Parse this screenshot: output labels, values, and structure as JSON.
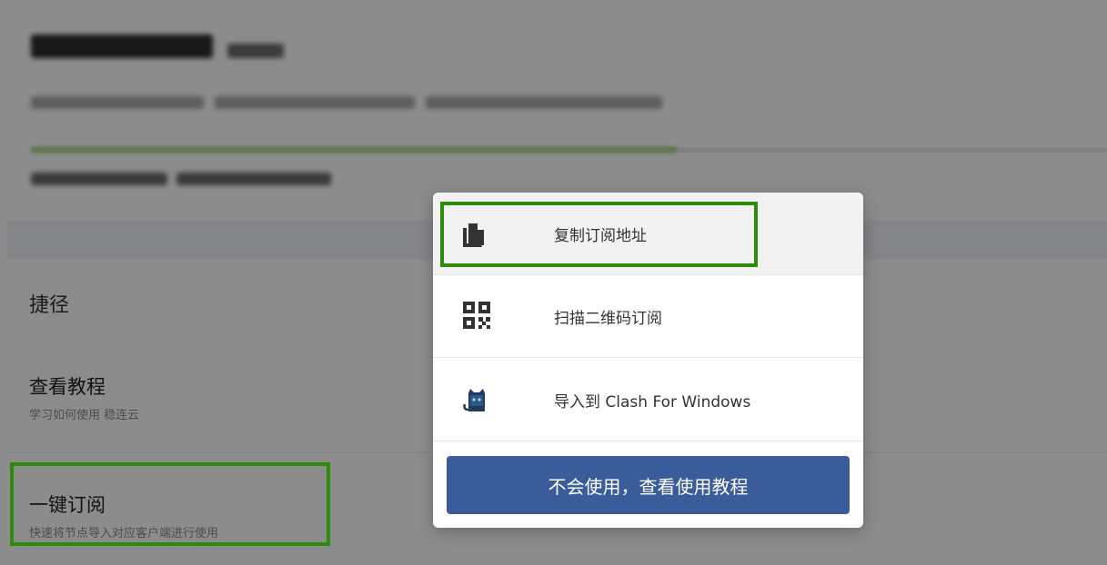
{
  "shortcuts": {
    "section_title": "捷径",
    "tutorial": {
      "title": "查看教程",
      "subtitle": "学习如何使用 稳连云"
    },
    "subscribe": {
      "title": "一键订阅",
      "subtitle": "快速将节点导入对应客户端进行使用"
    }
  },
  "plan": {
    "progress_fraction": 0.6
  },
  "menu": {
    "items": [
      {
        "label": "复制订阅地址",
        "icon": "copy-icon"
      },
      {
        "label": "扫描二维码订阅",
        "icon": "qr-code-icon"
      },
      {
        "label": "导入到 Clash For Windows",
        "icon": "clash-cat-icon"
      }
    ],
    "tutorial_button": "不会使用，查看使用教程"
  },
  "colors": {
    "highlight": "#2a8c0a",
    "primary_button": "#3b5c9b",
    "progress": "#9bd66f",
    "overlay": "rgba(0,0,0,0.45)"
  }
}
